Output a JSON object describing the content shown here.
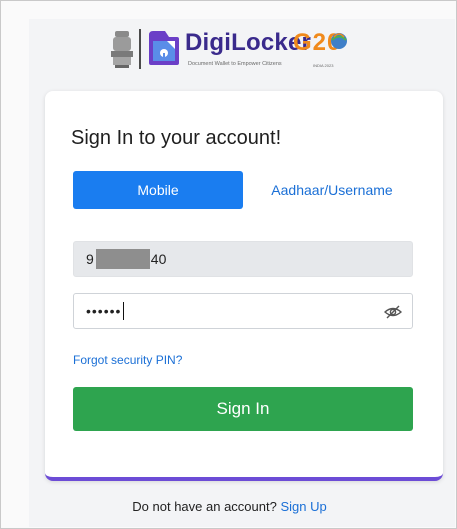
{
  "header": {
    "brand_name": "DigiLocker",
    "brand_tagline": "Document Wallet to Empower Citizens",
    "g20_text": "G20",
    "g20_subtitle": "INDIA 2023"
  },
  "card": {
    "title": "Sign In to your account!",
    "tabs": [
      {
        "label": "Mobile",
        "active": true
      },
      {
        "label": "Aadhaar/Username",
        "active": false
      }
    ],
    "mobile_field": {
      "value_start": "9",
      "value_end": "40"
    },
    "pin_field": {
      "value": "••••••"
    },
    "forgot_link": "Forgot security PIN?",
    "signin_button": "Sign In"
  },
  "footer": {
    "text": "Do not have an account?",
    "link": "Sign Up"
  },
  "colors": {
    "primary_blue": "#1a7df0",
    "link_blue": "#1a6fd6",
    "signin_green": "#2ea44f",
    "brand_purple": "#3a2a8c",
    "card_accent": "#6c4cd6",
    "g20_orange": "#f08a1c"
  }
}
